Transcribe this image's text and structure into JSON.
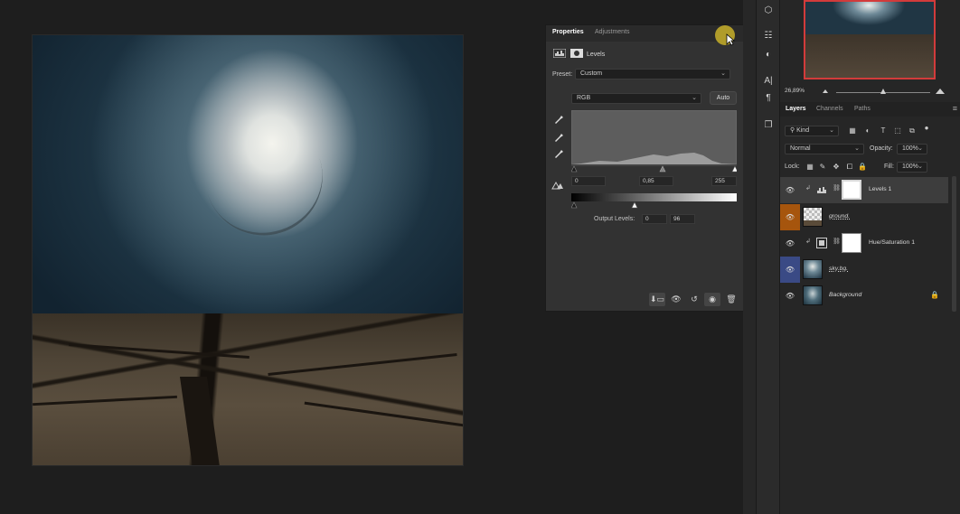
{
  "properties": {
    "tabs": [
      "Properties",
      "Adjustments"
    ],
    "adjustment_title": "Levels",
    "preset_label": "Preset:",
    "preset_value": "Custom",
    "channel_value": "RGB",
    "auto_label": "Auto",
    "input_black": "0",
    "input_gamma": "0,85",
    "input_white": "255",
    "output_label": "Output Levels:",
    "output_black": "0",
    "output_white": "96"
  },
  "navigator": {
    "zoom": "26,89%",
    "zoom_level": 0.5
  },
  "layers_panel": {
    "tabs": [
      "Layers",
      "Channels",
      "Paths"
    ],
    "kind_value": "Kind",
    "blend_mode": "Normal",
    "opacity_label": "Opacity:",
    "opacity_value": "100%",
    "lock_label": "Lock:",
    "fill_label": "Fill:",
    "fill_value": "100%",
    "layers": [
      {
        "name": "Levels 1"
      },
      {
        "name": "ground."
      },
      {
        "name": "Hue/Saturation 1"
      },
      {
        "name": "sky.bg."
      },
      {
        "name": "Background"
      }
    ]
  },
  "colors": {
    "accent_highlight": "#b7a22a",
    "navigator_frame": "#d23b3b",
    "orange_label": "#a6550d",
    "blue_label": "#3a4a85"
  }
}
